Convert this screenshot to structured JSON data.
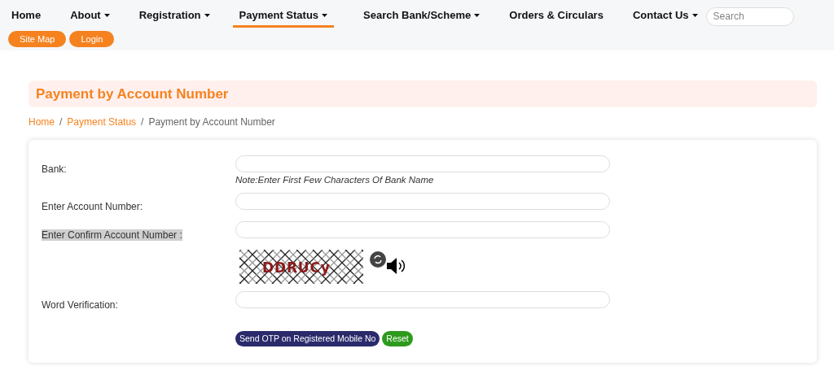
{
  "nav": {
    "items": [
      {
        "label": "Home",
        "dropdown": false,
        "selected": false
      },
      {
        "label": "About",
        "dropdown": true,
        "selected": false
      },
      {
        "label": "Registration",
        "dropdown": true,
        "selected": false
      },
      {
        "label": "Payment Status",
        "dropdown": true,
        "selected": true
      },
      {
        "label": "Search Bank/Scheme",
        "dropdown": true,
        "selected": false
      },
      {
        "label": "Orders & Circulars",
        "dropdown": false,
        "selected": false
      },
      {
        "label": "Contact Us",
        "dropdown": true,
        "selected": false
      }
    ],
    "search": {
      "placeholder": "Search"
    },
    "buttons": [
      "Site Map",
      "Login"
    ]
  },
  "page_title": "Payment by Account Number",
  "breadcrumb": [
    {
      "label": "Home",
      "link": true
    },
    {
      "separator": "/",
      "label": "Payment Status",
      "link": true
    },
    {
      "separator": "/",
      "label": "Payment by Account Number",
      "link": false
    }
  ],
  "form": {
    "fields": [
      {
        "kind": "input",
        "label": "Bank:",
        "note": "Note:Enter First Few Characters Of Bank Name",
        "highlighted": false
      },
      {
        "kind": "input",
        "label": "Enter Account Number:",
        "highlighted": false
      },
      {
        "kind": "input",
        "label": "Enter Confirm Account Number :",
        "highlighted": true
      },
      {
        "kind": "captcha",
        "captcha_text": "DDRUCy"
      },
      {
        "kind": "input",
        "label": "Word Verification:",
        "highlighted": false
      }
    ],
    "buttons": [
      {
        "label": "Send OTP on Registered Mobile No",
        "kind": "primary"
      },
      {
        "label": "Reset",
        "kind": "reset"
      }
    ]
  }
}
